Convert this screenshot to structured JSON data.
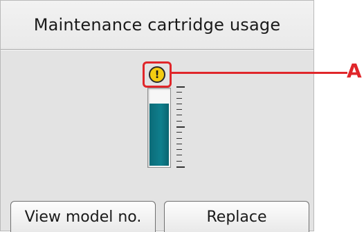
{
  "screen": {
    "title": "Maintenance cartridge usage"
  },
  "gauge": {
    "fill_fraction": 0.82,
    "warning_icon": "exclamation-warning-icon",
    "warning_symbol": "!",
    "warning_color": "#f4cc12",
    "fill_color": "#0f7f8d"
  },
  "callout": {
    "label": "A",
    "color": "#e0262a"
  },
  "buttons": {
    "view_model_label": "View model no.",
    "replace_label": "Replace"
  }
}
